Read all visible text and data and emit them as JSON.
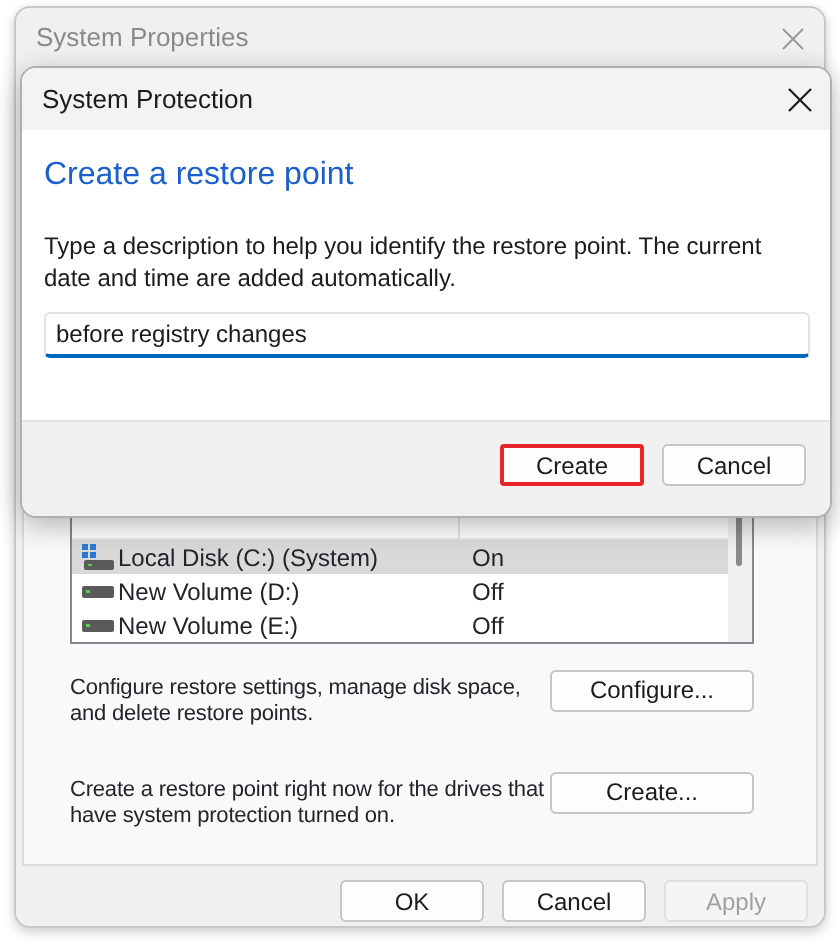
{
  "background_window": {
    "title": "System Properties",
    "drives_list": {
      "rows": [
        {
          "drive": "Local Disk (C:) (System)",
          "kind": "system",
          "protection": "On",
          "selected": true
        },
        {
          "drive": "New Volume (D:)",
          "kind": "volume",
          "protection": "Off",
          "selected": false
        },
        {
          "drive": "New Volume (E:)",
          "kind": "volume",
          "protection": "Off",
          "selected": false
        }
      ]
    },
    "actions": [
      {
        "description": "Configure restore settings, manage disk space, and delete restore points.",
        "button": "Configure..."
      },
      {
        "description": "Create a restore point right now for the drives that have system protection turned on.",
        "button": "Create..."
      }
    ],
    "buttons": [
      {
        "label": "OK",
        "disabled": false
      },
      {
        "label": "Cancel",
        "disabled": false
      },
      {
        "label": "Apply",
        "disabled": true
      }
    ]
  },
  "dialog": {
    "title": "System Protection",
    "heading": "Create a restore point",
    "description": "Type a description to help you identify the restore point. The current date and time are added automatically.",
    "input": {
      "value": "before registry changes"
    },
    "buttons": [
      {
        "label": "Create",
        "highlighted": true
      },
      {
        "label": "Cancel",
        "highlighted": false
      }
    ]
  }
}
